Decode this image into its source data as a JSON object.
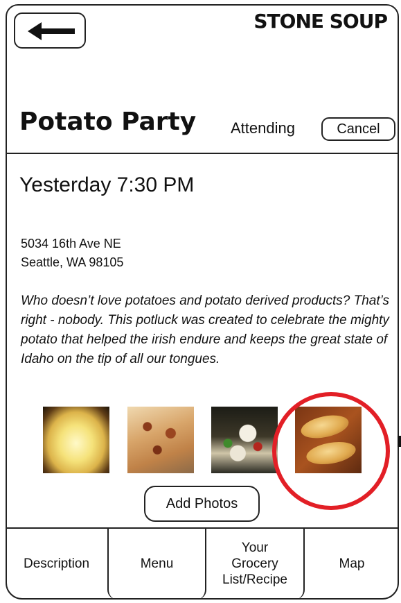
{
  "header": {
    "brand": "STONE SOUP",
    "back_icon": "left-arrow-icon"
  },
  "event": {
    "title": "Potato Party",
    "status": "Attending",
    "cancel_label": "Cancel",
    "datetime": "Yesterday 7:30 PM",
    "address_line1": "5034 16th Ave NE",
    "address_line2": "Seattle, WA 98105",
    "description": "Who doesn’t love potatoes and potato derived products? That’s right - nobody. This potluck was created to celebrate the mighty potato that helped the irish endure and keeps the great state of Idaho on the tip of all our tongues."
  },
  "photos": {
    "add_label": "Add Photos",
    "highlight_color": "#e21f26"
  },
  "tabs": [
    {
      "label": "Description"
    },
    {
      "label": "Menu"
    },
    {
      "label": "Your\nGrocery\nList/Recipe"
    },
    {
      "label": "Map"
    }
  ]
}
